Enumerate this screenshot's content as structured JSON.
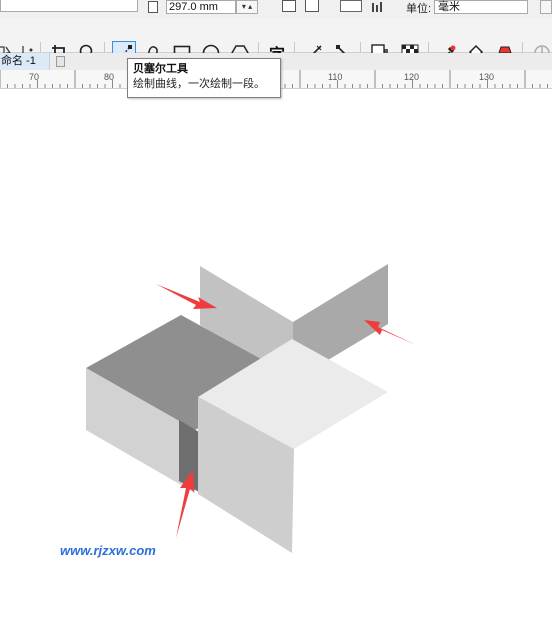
{
  "property_bar": {
    "page_height_value": "297.0 mm",
    "units_label": "单位:",
    "units_value": "毫米"
  },
  "toolbox": {
    "tools": [
      {
        "name": "shape-tool",
        "icon": "shape-icon"
      },
      {
        "name": "crop-tool",
        "icon": "crop-icon"
      },
      {
        "name": "zoom-tool",
        "icon": "zoom-icon"
      },
      {
        "name": "bezier-tool",
        "icon": "bezier-icon",
        "active": true
      },
      {
        "name": "artistic-media-tool",
        "icon": "artistic-media-icon"
      },
      {
        "name": "rectangle-tool",
        "icon": "rectangle-icon"
      },
      {
        "name": "ellipse-tool",
        "icon": "ellipse-icon"
      },
      {
        "name": "polygon-tool",
        "icon": "polygon-icon"
      },
      {
        "name": "text-tool",
        "icon": "text-icon",
        "label": "字"
      },
      {
        "name": "parallel-dimension-tool",
        "icon": "dimension-icon"
      },
      {
        "name": "connector-tool",
        "icon": "connector-icon"
      },
      {
        "name": "drop-shadow-tool",
        "icon": "drop-shadow-icon"
      },
      {
        "name": "transparency-tool",
        "icon": "transparency-icon"
      },
      {
        "name": "eyedropper-tool",
        "icon": "eyedropper-icon"
      },
      {
        "name": "interactive-fill-tool",
        "icon": "fill-icon"
      },
      {
        "name": "smart-fill-tool",
        "icon": "smart-fill-icon"
      },
      {
        "name": "color-proof-tool",
        "icon": "proof-icon"
      }
    ]
  },
  "document": {
    "tab_label": "命名 -1"
  },
  "ruler": {
    "ticks": [
      "70",
      "80",
      "90",
      "100",
      "110",
      "120",
      "130"
    ]
  },
  "tooltip": {
    "title": "贝塞尔工具",
    "description": "绘制曲线，一次绘制一段。"
  },
  "watermark": "www.rjzxw.com",
  "colors": {
    "arrow": "#f03c3c",
    "active_tool_border": "#3c8de0",
    "active_tool_bg": "#dcebfb",
    "watermark": "#2a6fdc"
  }
}
